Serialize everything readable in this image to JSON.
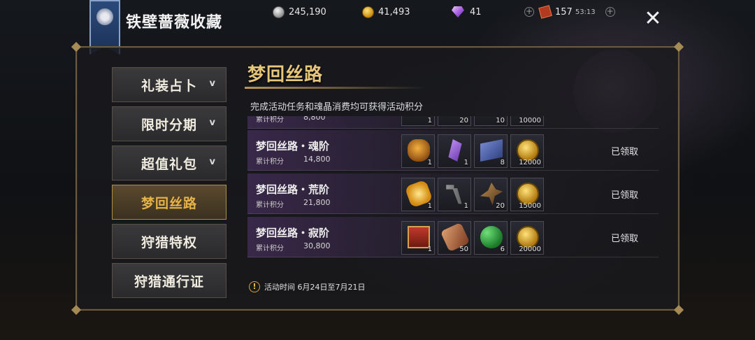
{
  "header": {
    "title": "铁壁蔷薇收藏",
    "currencies": [
      {
        "icon": "silver-coin-icon",
        "value": "245,190"
      },
      {
        "icon": "gold-coin-icon",
        "value": "41,493"
      },
      {
        "icon": "diamond-icon",
        "value": "41"
      },
      {
        "icon": "ticket-icon",
        "value": "157",
        "timer": "53:13"
      }
    ],
    "close_icon": "close-icon"
  },
  "nav": {
    "items": [
      {
        "label": "礼装占卜",
        "has_caret": true
      },
      {
        "label": "限时分期",
        "has_caret": true
      },
      {
        "label": "超值礼包",
        "has_caret": true
      },
      {
        "label": "梦回丝路",
        "active": true
      },
      {
        "label": "狩猎特权"
      },
      {
        "label": "狩猎通行证"
      }
    ],
    "caret": "v"
  },
  "content": {
    "title": "梦回丝路",
    "description": "完成活动任务和魂晶消费均可获得活动积分",
    "points_label": "累计积分",
    "partial_row": {
      "points": "8,800",
      "quantities": [
        "1",
        "20",
        "10",
        "10000"
      ]
    },
    "rows": [
      {
        "name": "梦回丝路・魂阶",
        "points": "14,800",
        "items": [
          {
            "icon": "bag-icon",
            "qty": "1"
          },
          {
            "icon": "crystal-icon",
            "qty": "1"
          },
          {
            "icon": "card-icon",
            "qty": "8"
          },
          {
            "icon": "gold-coin-icon",
            "qty": "12000"
          }
        ],
        "status": "已领取"
      },
      {
        "name": "梦回丝路・荒阶",
        "points": "21,800",
        "items": [
          {
            "icon": "lantern-icon",
            "qty": "1"
          },
          {
            "icon": "hammer-icon",
            "qty": "1"
          },
          {
            "icon": "claw-icon",
            "qty": "20"
          },
          {
            "icon": "gold-coin-icon",
            "qty": "15000"
          }
        ],
        "status": "已领取"
      },
      {
        "name": "梦回丝路・寂阶",
        "points": "30,800",
        "items": [
          {
            "icon": "chest-icon",
            "qty": "1"
          },
          {
            "icon": "scroll-icon",
            "qty": "50"
          },
          {
            "icon": "clover-icon",
            "qty": "6"
          },
          {
            "icon": "gold-coin-icon",
            "qty": "20000"
          }
        ],
        "status": "已领取"
      }
    ],
    "footer": {
      "icon": "warning-icon",
      "text": "活动时间 6月24日至7月21日"
    }
  }
}
